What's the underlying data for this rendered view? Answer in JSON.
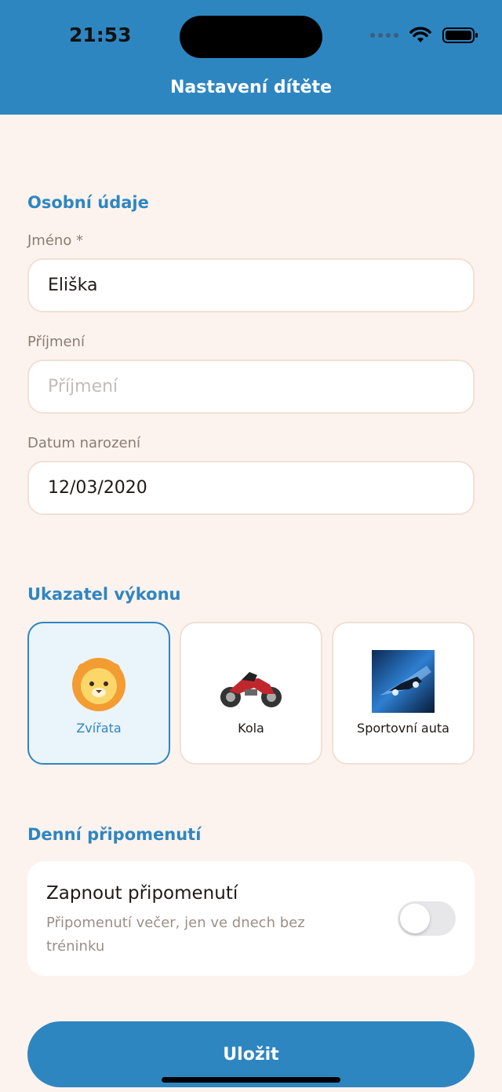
{
  "status_bar": {
    "time": "21:53"
  },
  "header": {
    "title": "Nastavení dítěte"
  },
  "personal": {
    "section_title": "Osobní údaje",
    "first_name": {
      "label": "Jméno *",
      "value": "Eliška"
    },
    "last_name": {
      "label": "Příjmení",
      "placeholder": "Příjmení"
    },
    "birth_date": {
      "label": "Datum narození",
      "value": "12/03/2020"
    }
  },
  "performance": {
    "section_title": "Ukazatel výkonu",
    "options": [
      {
        "label": "Zvířata",
        "icon": "lion-icon",
        "selected": true
      },
      {
        "label": "Kola",
        "icon": "motorcycle-icon",
        "selected": false
      },
      {
        "label": "Sportovní auta",
        "icon": "sports-car-icon",
        "selected": false
      }
    ]
  },
  "reminder": {
    "section_title": "Denní připomenutí",
    "title": "Zapnout připomenutí",
    "subtitle": "Připomenutí večer, jen ve dnech bez tréninku",
    "enabled": false
  },
  "save_label": "Uložit",
  "colors": {
    "accent": "#2e86c1",
    "background": "#fdf3ee"
  }
}
